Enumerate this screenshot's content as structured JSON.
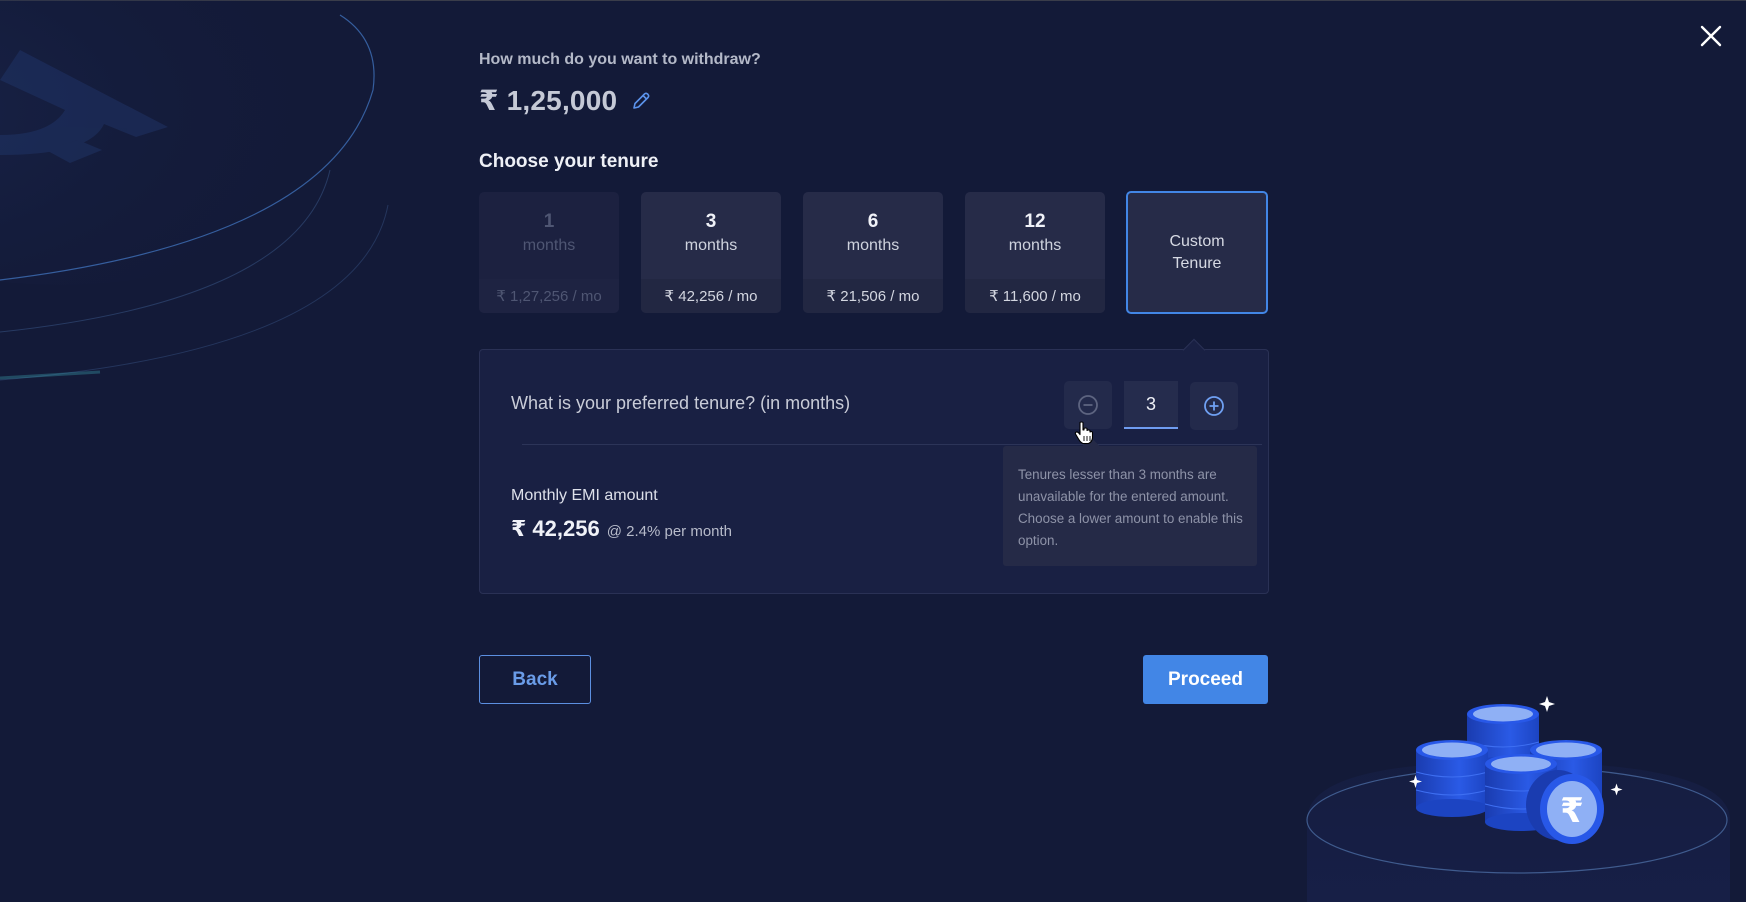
{
  "header": {
    "question": "How much do you want to withdraw?",
    "amount": "₹ 1,25,000",
    "close_icon": "close-icon",
    "edit_icon": "pencil-icon"
  },
  "tenure": {
    "title": "Choose your tenure",
    "options": [
      {
        "months": "1",
        "unit": "months",
        "emi": "₹ 1,27,256 / mo",
        "disabled": true
      },
      {
        "months": "3",
        "unit": "months",
        "emi": "₹ 42,256 / mo",
        "disabled": false
      },
      {
        "months": "6",
        "unit": "months",
        "emi": "₹ 21,506 / mo",
        "disabled": false
      },
      {
        "months": "12",
        "unit": "months",
        "emi": "₹ 11,600 / mo",
        "disabled": false
      }
    ],
    "custom": {
      "line1": "Custom",
      "line2": "Tenure",
      "selected": true
    }
  },
  "custom_panel": {
    "question": "What is your preferred tenure?  (in months)",
    "stepper_value": "3",
    "minus_icon": "minus-circle-icon",
    "plus_icon": "plus-circle-icon",
    "emi_label": "Monthly EMI amount",
    "emi_value": "₹ 42,256",
    "emi_rate": "@ 2.4% per month",
    "tooltip": "Tenures lesser than 3 months are unavailable for the entered amount. Choose a lower amount to enable this option."
  },
  "actions": {
    "back": "Back",
    "proceed": "Proceed"
  },
  "colors": {
    "background": "#131a38",
    "accent": "#4286e6",
    "card": "#262b48",
    "panel": "#192043"
  }
}
